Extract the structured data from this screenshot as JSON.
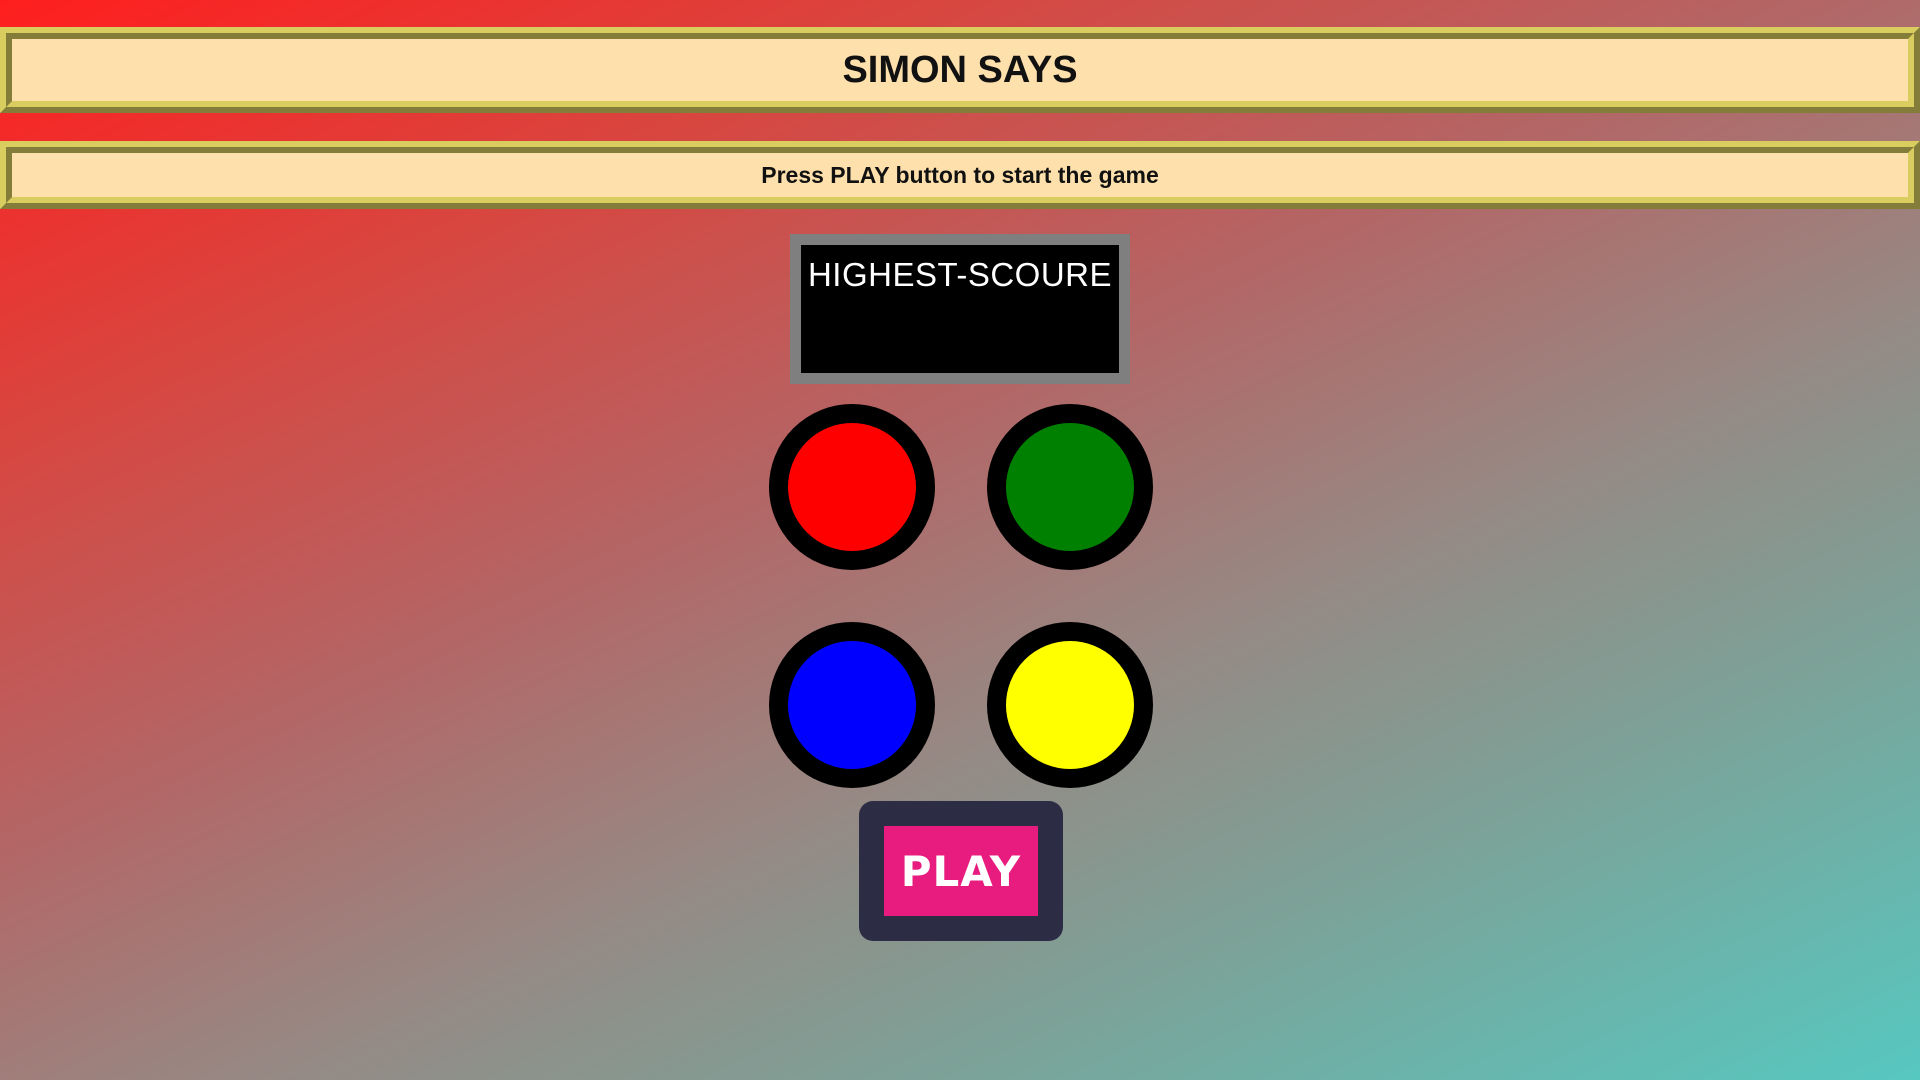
{
  "header": {
    "title": "SIMON SAYS"
  },
  "status": {
    "message": "Press PLAY button to start the game"
  },
  "scoreboard": {
    "label": "HIGHEST-SCOURE"
  },
  "pads": [
    {
      "name": "red-pad",
      "color": "#ff0000"
    },
    {
      "name": "green-pad",
      "color": "#008000"
    },
    {
      "name": "blue-pad",
      "color": "#0000ff"
    },
    {
      "name": "yellow-pad",
      "color": "#ffff00"
    }
  ],
  "controls": {
    "play_label": "PLAY",
    "play_color": "#e81c7f",
    "play_frame_color": "#2c2c45"
  }
}
